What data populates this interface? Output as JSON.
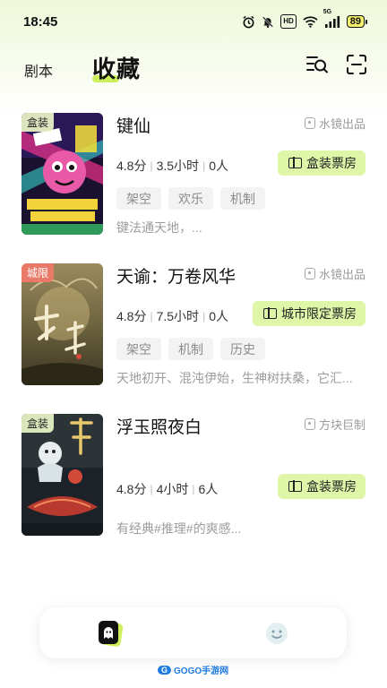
{
  "status_bar": {
    "time": "18:45",
    "network": "5G",
    "hd": "HD",
    "battery": "89"
  },
  "header": {
    "tab_script": "剧本",
    "tab_favorites": "收藏",
    "search_icon": "search-list-icon",
    "scan_icon": "scan-icon"
  },
  "cards": [
    {
      "badge": "盒装",
      "badge_color": "#ebf5c8",
      "title": "键仙",
      "publisher": "水镜出品",
      "score": "4.8分",
      "duration": "3.5小时",
      "players": "0人",
      "ticket": "盒装票房",
      "tags": [
        "架空",
        "欢乐",
        "机制"
      ],
      "description": "键法通天地，..."
    },
    {
      "badge": "城限",
      "badge_color": "#e97a6a",
      "title": "天谕：万卷风华",
      "publisher": "水镜出品",
      "score": "4.8分",
      "duration": "7.5小时",
      "players": "0人",
      "ticket": "城市限定票房",
      "tags": [
        "架空",
        "机制",
        "历史"
      ],
      "description": "天地初开、混沌伊始，生神树扶桑，它汇..."
    },
    {
      "badge": "盒装",
      "badge_color": "#ebf5c8",
      "title": "浮玉照夜白",
      "publisher": "方块巨制",
      "score": "4.8分",
      "duration": "4小时",
      "players": "6人",
      "ticket": "盒装票房",
      "tags": [],
      "description": "有经典#推理#的爽感..."
    }
  ],
  "bottom_nav": {
    "home_icon": "home-ghost-icon",
    "profile_icon": "face-icon"
  },
  "watermark": {
    "text": "GOGO手游网"
  },
  "colors": {
    "accent": "#cdf05a",
    "pill_bg": "#dff5a8"
  }
}
